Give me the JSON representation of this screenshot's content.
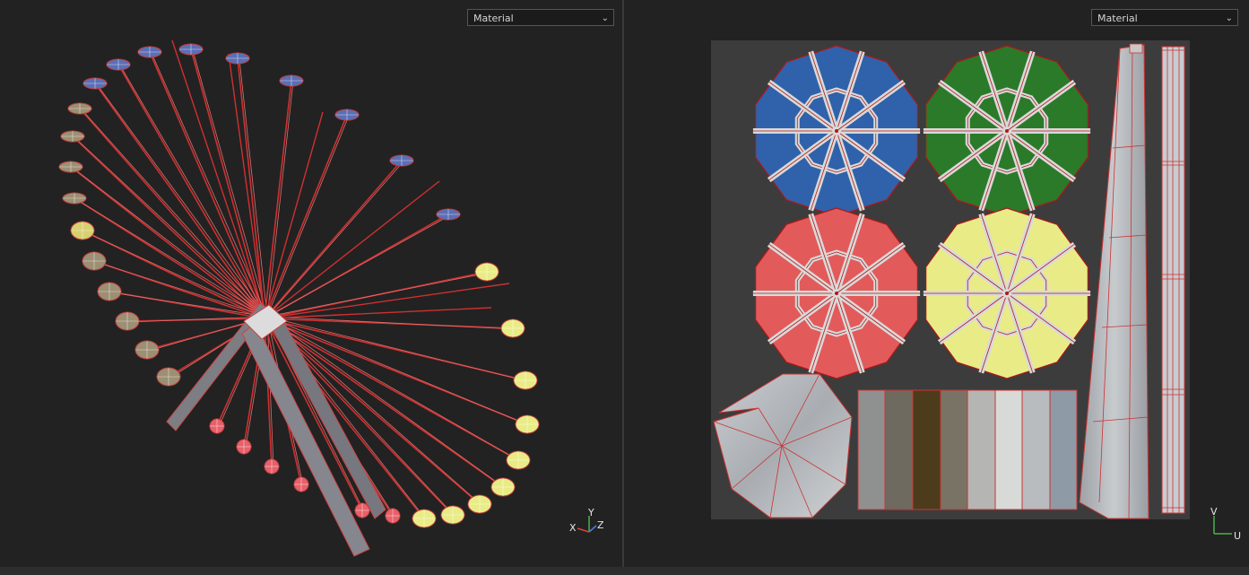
{
  "left_viewport": {
    "material_select": "Material",
    "axis": {
      "x": "X",
      "y": "Y",
      "z": "Z"
    }
  },
  "right_viewport": {
    "material_select": "Material",
    "axis": {
      "v": "V",
      "u": "U"
    }
  },
  "colors": {
    "blue": "#2f62aa",
    "green": "#2a7a2a",
    "red": "#e35a5a",
    "yellow": "#e9ec86",
    "wire": "#d03030"
  }
}
